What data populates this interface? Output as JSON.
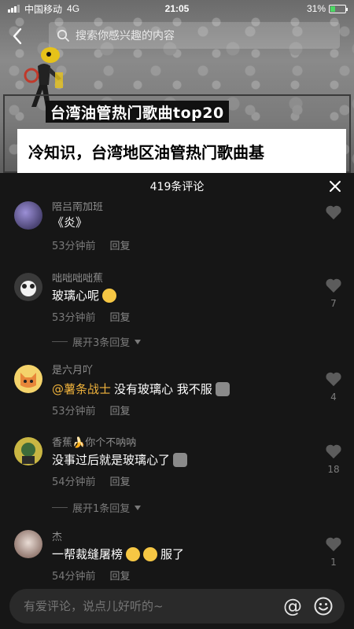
{
  "status_bar": {
    "carrier": "中国移动",
    "network": "4G",
    "time": "21:05",
    "battery": "31%",
    "battery_level": 0.31
  },
  "search": {
    "placeholder": "搜索你感兴趣的内容"
  },
  "video": {
    "title_banner": "台湾油管热门歌曲top20",
    "subtitle": "冷知识，台湾地区油管热门歌曲基"
  },
  "panel": {
    "title": "419条评论"
  },
  "comments": [
    {
      "name": "陪吕南加班",
      "text": "《炎》",
      "time": "53分钟前",
      "reply": "回复",
      "likes": ""
    },
    {
      "name": "咄咄咄咄蕉",
      "text": "玻璃心呢",
      "time": "53分钟前",
      "reply": "回复",
      "likes": "7",
      "expand": "展开3条回复"
    },
    {
      "name": "是六月吖",
      "mention": "@薯条战士",
      "text": "没有玻璃心 我不服",
      "time": "53分钟前",
      "reply": "回复",
      "likes": "4"
    },
    {
      "name_prefix": "香蕉",
      "name": "你个不呐呐",
      "text": "没事过后就是玻璃心了",
      "time": "54分钟前",
      "reply": "回复",
      "likes": "18",
      "expand": "展开1条回复"
    },
    {
      "name": "杰",
      "text": "一帮裁缝屠榜",
      "text_suffix": "服了",
      "time": "54分钟前",
      "reply": "回复",
      "likes": "1"
    }
  ],
  "input": {
    "placeholder": "有爱评论，说点儿好听的~",
    "at_symbol": "@"
  },
  "colors": {
    "background": "#161616",
    "mention": "#f0b33c",
    "muted": "#7a7a7a"
  }
}
